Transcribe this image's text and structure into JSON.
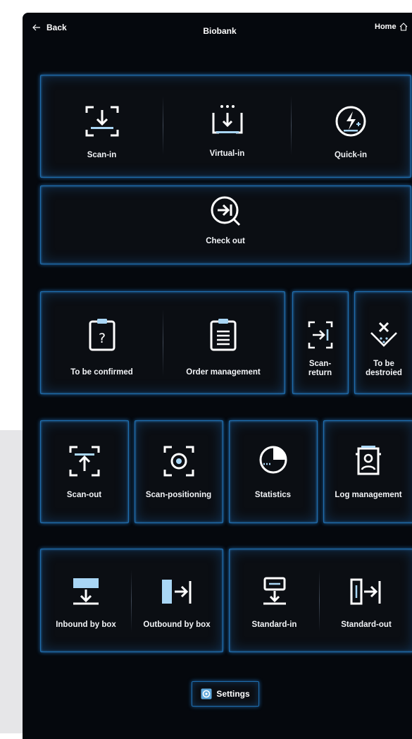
{
  "header": {
    "back_label": "Back",
    "title": "Biobank",
    "home_label": "Home"
  },
  "row1": [
    {
      "label": "Scan-in"
    },
    {
      "label": "Virtual-in"
    },
    {
      "label": "Quick-in"
    }
  ],
  "row2": {
    "label": "Check out"
  },
  "row3": [
    {
      "label": "To be confirmed"
    },
    {
      "label": "Order management"
    },
    {
      "label_line1": "Scan-",
      "label_line2": "return"
    },
    {
      "label_line1": "To be",
      "label_line2": "destroied"
    }
  ],
  "row4": [
    {
      "label": "Scan-out"
    },
    {
      "label": "Scan-positioning"
    },
    {
      "label": "Statistics"
    },
    {
      "label": "Log management"
    }
  ],
  "row5": [
    {
      "label": "Inbound by box"
    },
    {
      "label": "Outbound by box"
    },
    {
      "label": "Standard-in"
    },
    {
      "label": "Standard-out"
    }
  ],
  "settings": {
    "label": "Settings"
  },
  "colors": {
    "accent_blue": "#1f6fb0",
    "background": "#05080d",
    "icon_light_blue": "#a9d6f5"
  }
}
